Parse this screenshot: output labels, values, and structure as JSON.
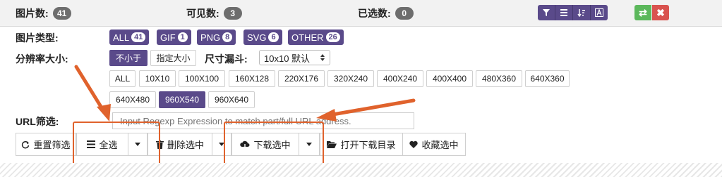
{
  "header": {
    "total_label": "图片数:",
    "total_count": "41",
    "visible_label": "可见数:",
    "visible_count": "3",
    "selected_label": "已选数:",
    "selected_count": "0",
    "tools": [
      "filter-icon",
      "list-icon",
      "sort-icon",
      "a-icon"
    ],
    "swap_symbol": "⇄",
    "close_symbol": "✖"
  },
  "image_type": {
    "label": "图片类型:",
    "tags": [
      {
        "name": "ALL",
        "count": "41"
      },
      {
        "name": "GIF",
        "count": "1"
      },
      {
        "name": "PNG",
        "count": "8"
      },
      {
        "name": "SVG",
        "count": "6"
      },
      {
        "name": "OTHER",
        "count": "26"
      }
    ]
  },
  "resolution": {
    "label": "分辨率大小:",
    "not_less_btn": "不小于",
    "specify_btn": "指定大小",
    "funnel_label": "尺寸漏斗:",
    "funnel_value": "10x10 默认",
    "sizes_row1": [
      "ALL",
      "10X10",
      "100X100",
      "160X128",
      "220X176",
      "320X240",
      "400X240",
      "400X400",
      "480X360",
      "640X360"
    ],
    "sizes_row2": [
      "640X480",
      "960X540",
      "960X640"
    ],
    "selected_size": "960X540"
  },
  "url_filter": {
    "label": "URL筛选:",
    "placeholder": "Input Regexp Expression to match part/full URL address."
  },
  "actions": {
    "reset": "重置筛选",
    "select_all": "全选",
    "delete_selected": "删除选中",
    "download_selected": "下载选中",
    "open_download_dir": "打开下载目录",
    "favorite_selected": "收藏选中"
  },
  "colors": {
    "accent": "#5a4a8a",
    "highlight": "#e0622c",
    "green": "#5cb85c",
    "red": "#d9534f"
  }
}
